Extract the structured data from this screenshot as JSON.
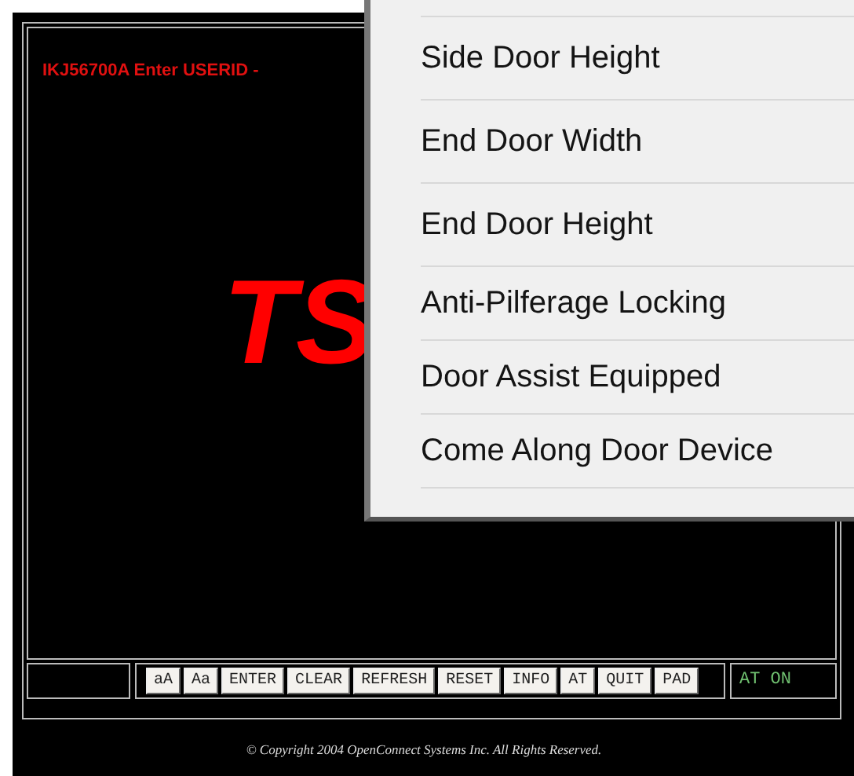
{
  "terminal": {
    "message": "IKJ56700A Enter USERID -",
    "logo": "TS"
  },
  "toolbar": {
    "buttons": [
      "aA",
      "Aa",
      "ENTER",
      "CLEAR",
      "REFRESH",
      "RESET",
      "INFO",
      "AT",
      "QUIT",
      "PAD"
    ],
    "status": "AT ON"
  },
  "footer": "© Copyright 2004 OpenConnect Systems Inc. All Rights Reserved.",
  "overlay_list": {
    "items": [
      "Side Door Height",
      "End Door Width",
      "End Door Height",
      "Anti-Pilferage Locking",
      "Door Assist Equipped",
      "Come Along Door Device"
    ]
  }
}
